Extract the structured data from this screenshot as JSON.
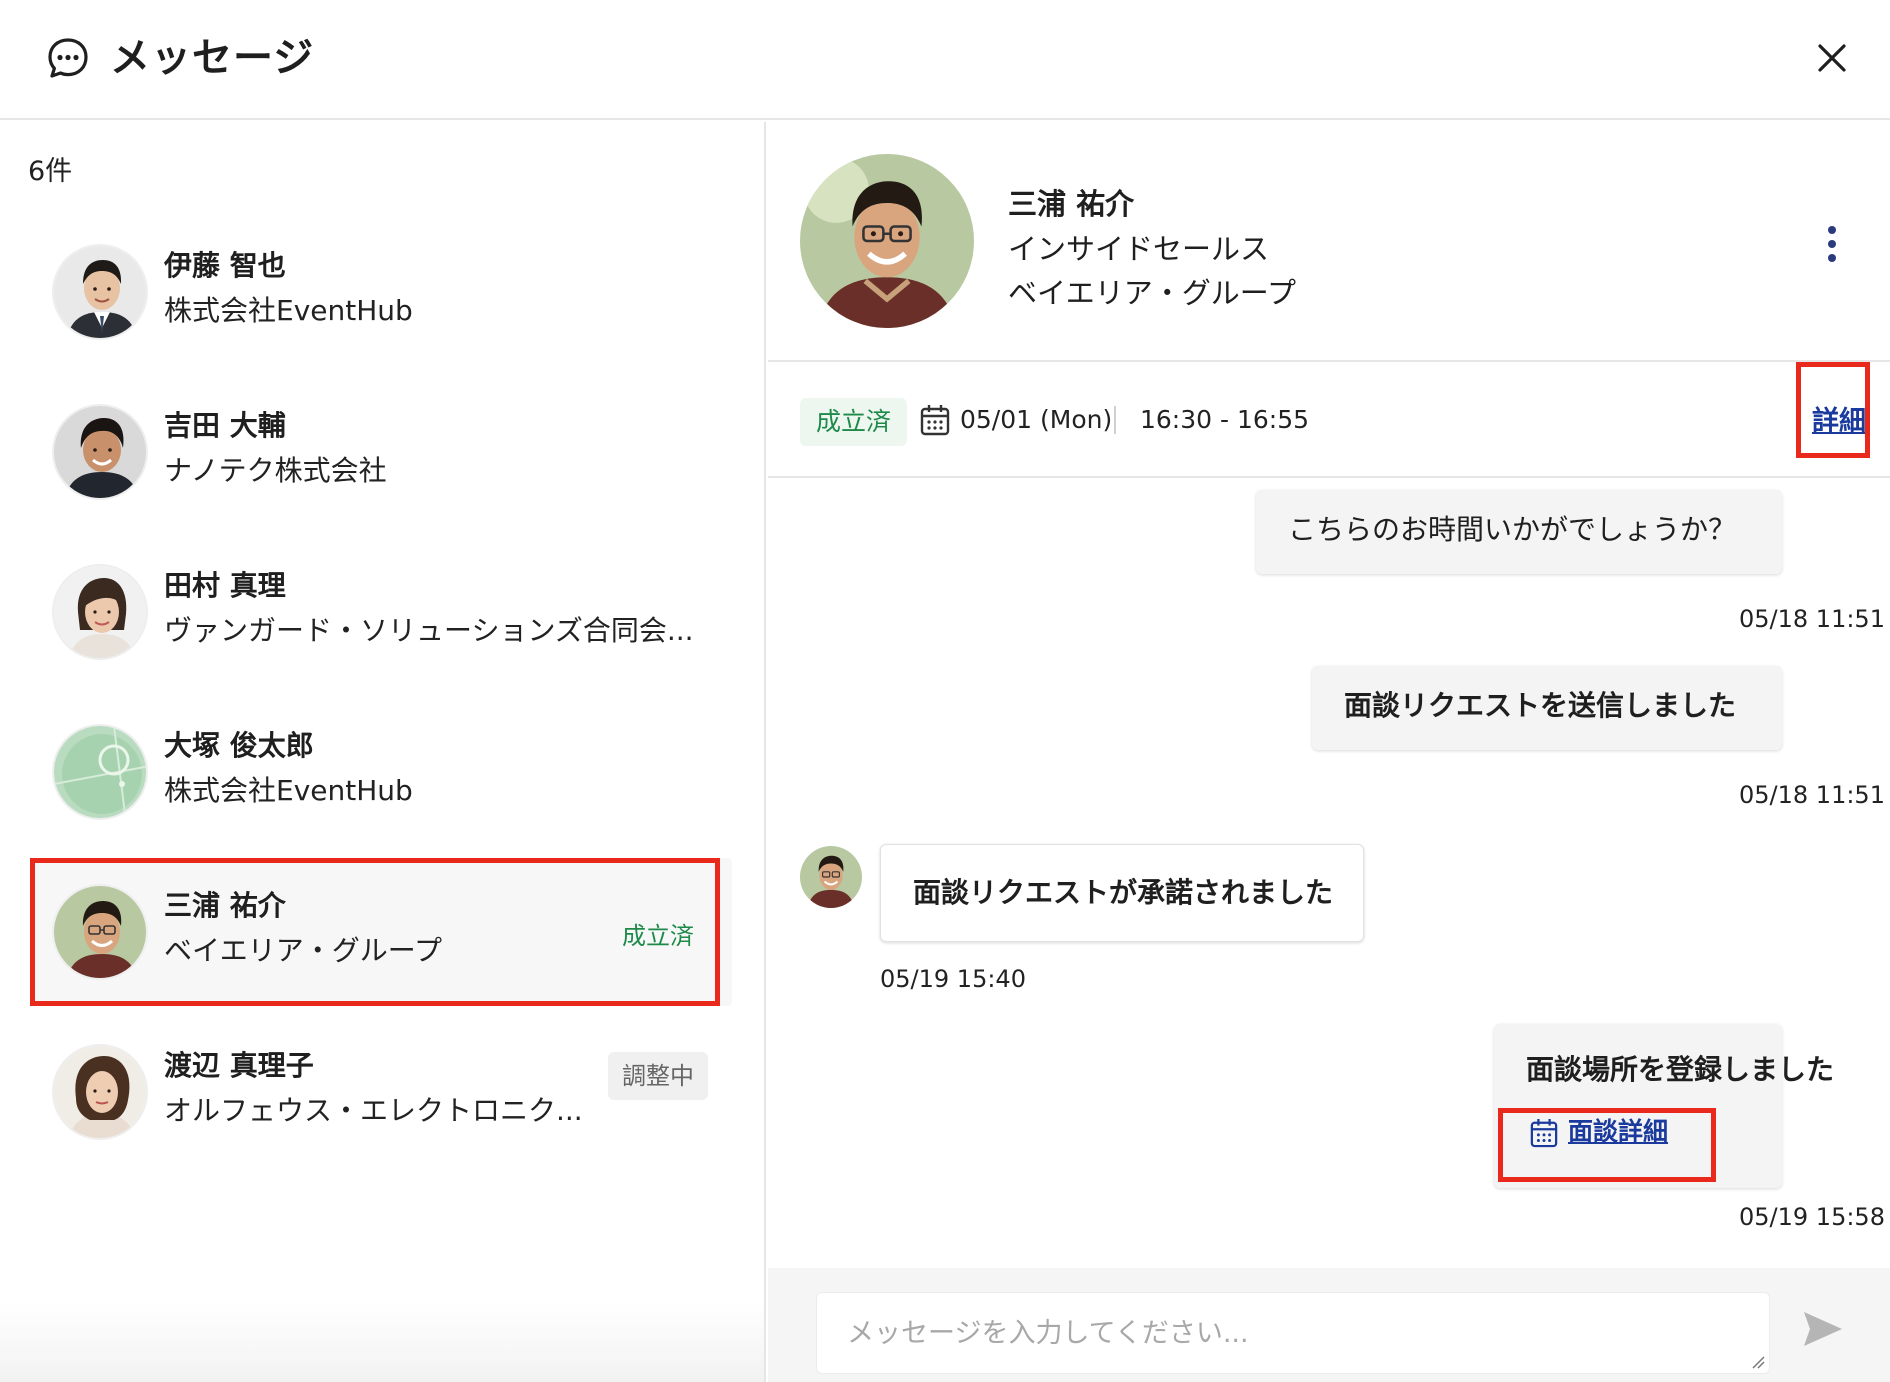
{
  "header": {
    "title": "メッセージ",
    "icon": "chat-bubble-icon",
    "close_icon": "close-icon"
  },
  "list": {
    "count": "6件",
    "contacts": [
      {
        "name": "伊藤 智也",
        "company": "株式会社EventHub",
        "badge": ""
      },
      {
        "name": "吉田 大輔",
        "company": "ナノテク株式会社",
        "badge": ""
      },
      {
        "name": "田村 真理",
        "company": "ヴァンガード・ソリューションズ合同会...",
        "badge": ""
      },
      {
        "name": "大塚 俊太郎",
        "company": "株式会社EventHub",
        "badge": ""
      },
      {
        "name": "三浦 祐介",
        "company": "ベイエリア・グループ",
        "badge": "成立済",
        "selected": true
      },
      {
        "name": "渡辺 真理子",
        "company": "オルフェウス・エレクトロニク...",
        "badge": "調整中"
      }
    ]
  },
  "profile": {
    "name": "三浦 祐介",
    "role": "インサイドセールス",
    "company": "ベイエリア・グループ"
  },
  "meeting": {
    "status": "成立済",
    "date": "05/01 (Mon)",
    "time": "16:30 - 16:55",
    "detail_link": "詳細"
  },
  "messages": [
    {
      "text": "こちらのお時間いかがでしょうか？",
      "timestamp": "05/18 11:51",
      "direction": "outgoing"
    },
    {
      "text": "面談リクエストを送信しました",
      "timestamp": "05/18 11:51",
      "direction": "outgoing"
    },
    {
      "text": "面談リクエストが承諾されました",
      "timestamp": "05/19 15:40",
      "direction": "incoming"
    },
    {
      "text": "面談場所を登録しました",
      "link": "面談詳細",
      "timestamp": "05/19 15:58",
      "direction": "outgoing"
    }
  ],
  "composer": {
    "placeholder": "メッセージを入力してください..."
  },
  "colors": {
    "accent_green": "#1e8a4a",
    "link_blue": "#1a3a9e",
    "highlight_red": "#e8291c"
  }
}
